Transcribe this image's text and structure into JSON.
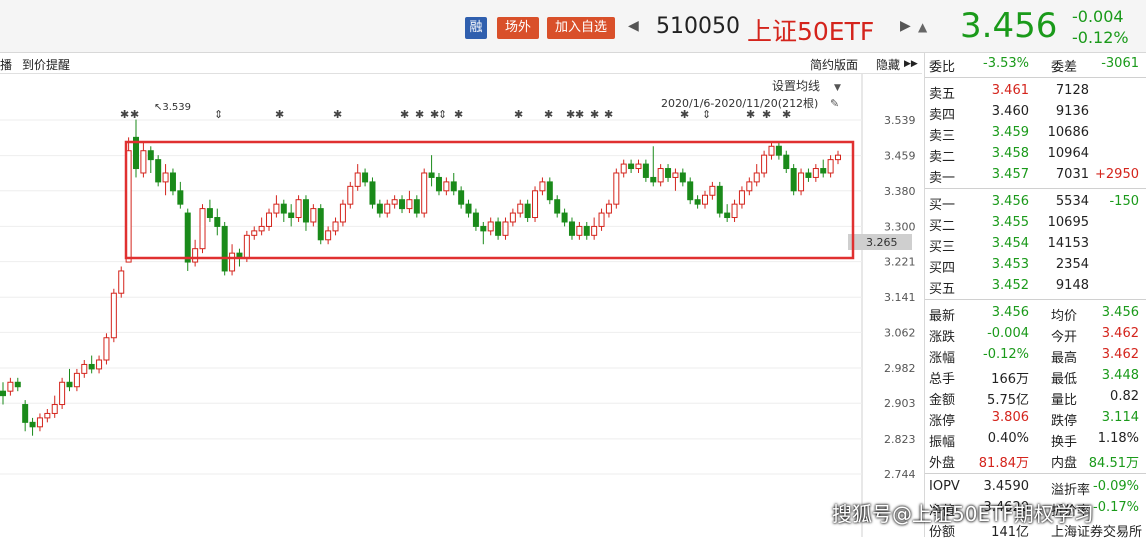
{
  "header": {
    "tag_rong": "融",
    "tag_offexchange": "场外",
    "tag_add_watch": "加入自选",
    "code": "510050",
    "name": "上证50ETF",
    "price": "3.456",
    "change": "-0.004",
    "change_pct": "-0.12%"
  },
  "subbar": {
    "left_clip": "播",
    "price_alert": "到价提醒",
    "simple_layout": "简约版面",
    "hide": "隐藏"
  },
  "chart_toolbar": {
    "set_ma": "设置均线",
    "range": "2020/1/6-2020/11/20(212根)"
  },
  "chart_data": {
    "type": "candlestick",
    "y_ticks": [
      "3.539",
      "3.459",
      "3.380",
      "3.300",
      "3.221",
      "3.141",
      "3.062",
      "2.982",
      "2.903",
      "2.823",
      "2.744"
    ],
    "ylim": [
      2.7,
      3.6
    ],
    "current_marker": "3.265",
    "high_annotation": "3.539",
    "candles": [
      [
        2.93,
        2.92,
        2.95,
        2.9
      ],
      [
        2.93,
        2.95,
        2.96,
        2.92
      ],
      [
        2.95,
        2.94,
        2.96,
        2.93
      ],
      [
        2.9,
        2.86,
        2.91,
        2.84
      ],
      [
        2.86,
        2.85,
        2.87,
        2.83
      ],
      [
        2.85,
        2.87,
        2.88,
        2.84
      ],
      [
        2.87,
        2.88,
        2.89,
        2.86
      ],
      [
        2.88,
        2.9,
        2.92,
        2.87
      ],
      [
        2.9,
        2.95,
        2.96,
        2.89
      ],
      [
        2.95,
        2.94,
        2.98,
        2.93
      ],
      [
        2.94,
        2.97,
        2.98,
        2.93
      ],
      [
        2.97,
        2.99,
        3.0,
        2.96
      ],
      [
        2.99,
        2.98,
        3.01,
        2.97
      ],
      [
        2.98,
        3.0,
        3.01,
        2.97
      ],
      [
        3.0,
        3.05,
        3.06,
        2.99
      ],
      [
        3.05,
        3.15,
        3.16,
        3.04
      ],
      [
        3.15,
        3.2,
        3.21,
        3.14
      ],
      [
        3.22,
        3.47,
        3.5,
        3.22
      ],
      [
        3.5,
        3.43,
        3.54,
        3.41
      ],
      [
        3.42,
        3.47,
        3.49,
        3.41
      ],
      [
        3.47,
        3.45,
        3.48,
        3.42
      ],
      [
        3.45,
        3.4,
        3.46,
        3.39
      ],
      [
        3.4,
        3.42,
        3.44,
        3.37
      ],
      [
        3.42,
        3.38,
        3.43,
        3.37
      ],
      [
        3.38,
        3.35,
        3.4,
        3.34
      ],
      [
        3.33,
        3.22,
        3.34,
        3.2
      ],
      [
        3.22,
        3.25,
        3.27,
        3.21
      ],
      [
        3.25,
        3.34,
        3.35,
        3.24
      ],
      [
        3.34,
        3.32,
        3.36,
        3.31
      ],
      [
        3.32,
        3.3,
        3.34,
        3.28
      ],
      [
        3.3,
        3.2,
        3.31,
        3.19
      ],
      [
        3.2,
        3.24,
        3.26,
        3.19
      ],
      [
        3.24,
        3.23,
        3.25,
        3.21
      ],
      [
        3.23,
        3.28,
        3.29,
        3.22
      ],
      [
        3.28,
        3.29,
        3.3,
        3.27
      ],
      [
        3.29,
        3.3,
        3.32,
        3.28
      ],
      [
        3.3,
        3.33,
        3.34,
        3.29
      ],
      [
        3.33,
        3.35,
        3.37,
        3.32
      ],
      [
        3.35,
        3.33,
        3.36,
        3.31
      ],
      [
        3.33,
        3.32,
        3.35,
        3.3
      ],
      [
        3.32,
        3.36,
        3.37,
        3.31
      ],
      [
        3.36,
        3.31,
        3.37,
        3.29
      ],
      [
        3.31,
        3.34,
        3.35,
        3.3
      ],
      [
        3.34,
        3.27,
        3.35,
        3.26
      ],
      [
        3.27,
        3.29,
        3.3,
        3.26
      ],
      [
        3.29,
        3.31,
        3.32,
        3.28
      ],
      [
        3.31,
        3.35,
        3.36,
        3.3
      ],
      [
        3.35,
        3.39,
        3.4,
        3.34
      ],
      [
        3.39,
        3.42,
        3.44,
        3.38
      ],
      [
        3.42,
        3.4,
        3.43,
        3.39
      ],
      [
        3.4,
        3.35,
        3.41,
        3.34
      ],
      [
        3.35,
        3.33,
        3.36,
        3.32
      ],
      [
        3.33,
        3.35,
        3.36,
        3.32
      ],
      [
        3.35,
        3.36,
        3.37,
        3.34
      ],
      [
        3.36,
        3.34,
        3.37,
        3.33
      ],
      [
        3.34,
        3.36,
        3.38,
        3.33
      ],
      [
        3.36,
        3.33,
        3.37,
        3.32
      ],
      [
        3.33,
        3.42,
        3.43,
        3.32
      ],
      [
        3.42,
        3.41,
        3.46,
        3.39
      ],
      [
        3.41,
        3.38,
        3.42,
        3.37
      ],
      [
        3.38,
        3.4,
        3.41,
        3.37
      ],
      [
        3.4,
        3.38,
        3.42,
        3.37
      ],
      [
        3.38,
        3.35,
        3.39,
        3.34
      ],
      [
        3.35,
        3.33,
        3.36,
        3.32
      ],
      [
        3.33,
        3.3,
        3.34,
        3.29
      ],
      [
        3.3,
        3.29,
        3.31,
        3.26
      ],
      [
        3.29,
        3.31,
        3.32,
        3.28
      ],
      [
        3.31,
        3.28,
        3.32,
        3.27
      ],
      [
        3.28,
        3.31,
        3.32,
        3.27
      ],
      [
        3.31,
        3.33,
        3.34,
        3.3
      ],
      [
        3.33,
        3.35,
        3.36,
        3.32
      ],
      [
        3.35,
        3.32,
        3.36,
        3.31
      ],
      [
        3.32,
        3.38,
        3.39,
        3.31
      ],
      [
        3.38,
        3.4,
        3.41,
        3.37
      ],
      [
        3.4,
        3.36,
        3.41,
        3.35
      ],
      [
        3.36,
        3.33,
        3.37,
        3.32
      ],
      [
        3.33,
        3.31,
        3.34,
        3.3
      ],
      [
        3.31,
        3.28,
        3.32,
        3.27
      ],
      [
        3.28,
        3.3,
        3.31,
        3.27
      ],
      [
        3.3,
        3.28,
        3.31,
        3.27
      ],
      [
        3.28,
        3.3,
        3.32,
        3.27
      ],
      [
        3.3,
        3.33,
        3.34,
        3.29
      ],
      [
        3.33,
        3.35,
        3.36,
        3.32
      ],
      [
        3.35,
        3.42,
        3.43,
        3.34
      ],
      [
        3.42,
        3.44,
        3.45,
        3.41
      ],
      [
        3.44,
        3.43,
        3.45,
        3.42
      ],
      [
        3.43,
        3.44,
        3.45,
        3.42
      ],
      [
        3.44,
        3.41,
        3.45,
        3.4
      ],
      [
        3.41,
        3.4,
        3.48,
        3.39
      ],
      [
        3.4,
        3.43,
        3.44,
        3.39
      ],
      [
        3.43,
        3.41,
        3.44,
        3.4
      ],
      [
        3.41,
        3.42,
        3.43,
        3.38
      ],
      [
        3.42,
        3.4,
        3.43,
        3.39
      ],
      [
        3.4,
        3.36,
        3.41,
        3.35
      ],
      [
        3.36,
        3.35,
        3.37,
        3.34
      ],
      [
        3.35,
        3.37,
        3.38,
        3.34
      ],
      [
        3.37,
        3.39,
        3.4,
        3.36
      ],
      [
        3.39,
        3.33,
        3.4,
        3.32
      ],
      [
        3.33,
        3.32,
        3.35,
        3.31
      ],
      [
        3.32,
        3.35,
        3.36,
        3.31
      ],
      [
        3.35,
        3.38,
        3.39,
        3.34
      ],
      [
        3.38,
        3.4,
        3.41,
        3.37
      ],
      [
        3.4,
        3.42,
        3.44,
        3.39
      ],
      [
        3.42,
        3.46,
        3.47,
        3.41
      ],
      [
        3.46,
        3.48,
        3.49,
        3.45
      ],
      [
        3.48,
        3.46,
        3.49,
        3.45
      ],
      [
        3.46,
        3.43,
        3.47,
        3.42
      ],
      [
        3.43,
        3.38,
        3.44,
        3.37
      ],
      [
        3.38,
        3.42,
        3.43,
        3.37
      ],
      [
        3.42,
        3.41,
        3.43,
        3.4
      ],
      [
        3.41,
        3.43,
        3.44,
        3.4
      ],
      [
        3.43,
        3.42,
        3.45,
        3.41
      ],
      [
        3.42,
        3.45,
        3.46,
        3.41
      ],
      [
        3.45,
        3.46,
        3.47,
        3.44
      ]
    ]
  },
  "panel": {
    "rows1": [
      {
        "l": "委比",
        "v": "-3.53%",
        "c": "grn",
        "l2": "委差",
        "v2": "-3061",
        "c2": "grn"
      }
    ],
    "asks": [
      {
        "l": "卖五",
        "p": "3.461",
        "pc": "red",
        "q": "7128",
        "x": ""
      },
      {
        "l": "卖四",
        "p": "3.460",
        "pc": "blk",
        "q": "9136",
        "x": ""
      },
      {
        "l": "卖三",
        "p": "3.459",
        "pc": "grn",
        "q": "10686",
        "x": ""
      },
      {
        "l": "卖二",
        "p": "3.458",
        "pc": "grn",
        "q": "10964",
        "x": ""
      },
      {
        "l": "卖一",
        "p": "3.457",
        "pc": "grn",
        "q": "7031",
        "x": "+2950",
        "xc": "red"
      }
    ],
    "bids": [
      {
        "l": "买一",
        "p": "3.456",
        "pc": "grn",
        "q": "5534",
        "x": "-150",
        "xc": "grn"
      },
      {
        "l": "买二",
        "p": "3.455",
        "pc": "grn",
        "q": "10695",
        "x": ""
      },
      {
        "l": "买三",
        "p": "3.454",
        "pc": "grn",
        "q": "14153",
        "x": ""
      },
      {
        "l": "买四",
        "p": "3.453",
        "pc": "grn",
        "q": "2354",
        "x": ""
      },
      {
        "l": "买五",
        "p": "3.452",
        "pc": "grn",
        "q": "9148",
        "x": ""
      }
    ],
    "stats": [
      {
        "l": "最新",
        "v": "3.456",
        "c": "grn",
        "l2": "均价",
        "v2": "3.456",
        "c2": "grn"
      },
      {
        "l": "涨跌",
        "v": "-0.004",
        "c": "grn",
        "l2": "今开",
        "v2": "3.462",
        "c2": "red"
      },
      {
        "l": "涨幅",
        "v": "-0.12%",
        "c": "grn",
        "l2": "最高",
        "v2": "3.462",
        "c2": "red"
      },
      {
        "l": "总手",
        "v": "166万",
        "c": "blk",
        "l2": "最低",
        "v2": "3.448",
        "c2": "grn"
      },
      {
        "l": "金额",
        "v": "5.75亿",
        "c": "blk",
        "l2": "量比",
        "v2": "0.82",
        "c2": "blk"
      },
      {
        "l": "涨停",
        "v": "3.806",
        "c": "red",
        "l2": "跌停",
        "v2": "3.114",
        "c2": "grn"
      },
      {
        "l": "振幅",
        "v": "0.40%",
        "c": "blk",
        "l2": "换手",
        "v2": "1.18%",
        "c2": "blk"
      },
      {
        "l": "外盘",
        "v": "81.84万",
        "c": "red",
        "l2": "内盘",
        "v2": "84.51万",
        "c2": "grn"
      }
    ],
    "extra": [
      {
        "l": "IOPV",
        "v": "3.4590",
        "c": "blk",
        "l2": "溢折率",
        "v2": "-0.09%",
        "c2": "grn"
      },
      {
        "l": "净值",
        "v": "3.4620",
        "c": "blk",
        "l2": "折价率",
        "v2": "-0.17%",
        "c2": "grn"
      },
      {
        "l": "份额",
        "v": "141亿",
        "c": "blk",
        "l2": "上海证券交易所",
        "v2": "",
        "c2": "blk"
      }
    ]
  },
  "watermark": "搜狐号@上证50ETF期权学习"
}
